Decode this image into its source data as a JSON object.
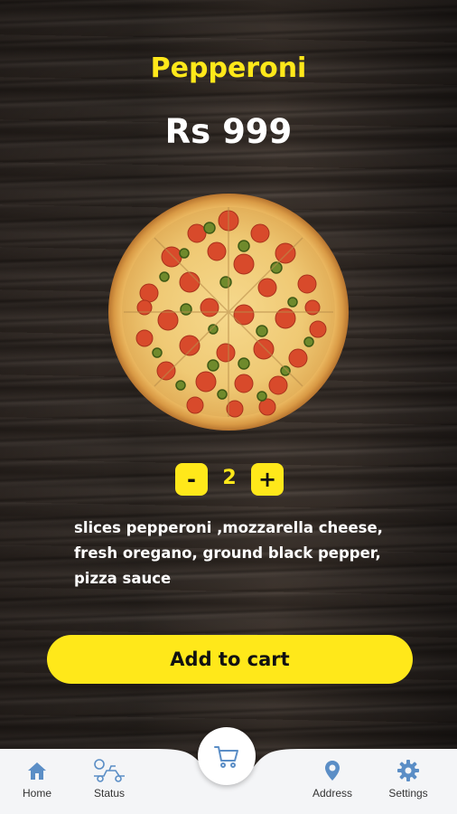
{
  "product": {
    "name": "Pepperoni",
    "price": "Rs 999",
    "quantity": "2",
    "minus_label": "-",
    "plus_label": "+",
    "description": "slices pepperoni ,mozzarella cheese,\nfresh oregano,  ground black pepper,\npizza sauce"
  },
  "actions": {
    "add_to_cart": "Add to cart"
  },
  "nav": {
    "items": [
      {
        "label": "Home",
        "icon": "home-icon"
      },
      {
        "label": "Status",
        "icon": "delivery-icon"
      },
      {
        "label": "Address",
        "icon": "location-pin-icon"
      },
      {
        "label": "Settings",
        "icon": "gear-icon"
      }
    ],
    "center_icon": "cart-icon"
  },
  "colors": {
    "accent": "#ffe81a",
    "nav_icon": "#5b8ec6",
    "nav_bg": "#f4f5f7"
  }
}
